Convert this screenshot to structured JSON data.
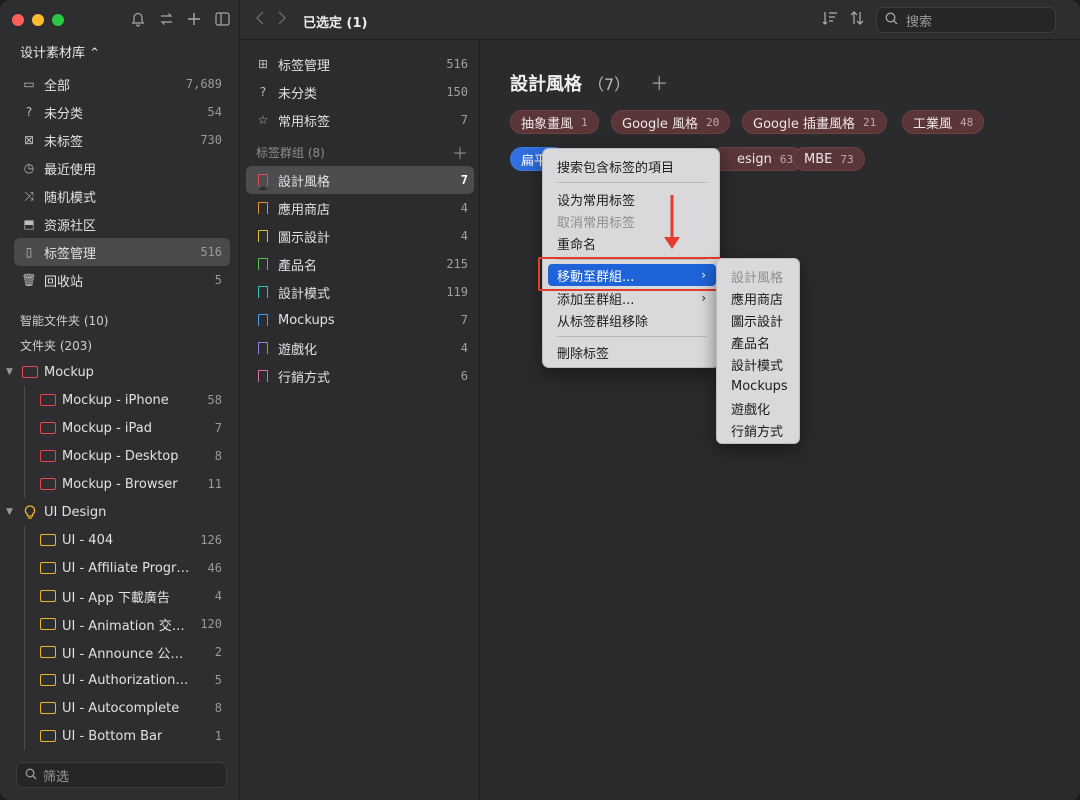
{
  "sidebar": {
    "library_title": "设计素材库 ⌃",
    "nav": [
      {
        "label": "全部",
        "count": "7,689",
        "icon": "inbox-icon",
        "glyph": "▭"
      },
      {
        "label": "未分类",
        "count": "54",
        "icon": "unsorted-icon",
        "glyph": "?"
      },
      {
        "label": "未标签",
        "count": "730",
        "icon": "untagged-icon",
        "glyph": "⊠"
      },
      {
        "label": "最近使用",
        "count": "",
        "icon": "clock-icon",
        "glyph": "◷"
      },
      {
        "label": "随机模式",
        "count": "",
        "icon": "shuffle-icon",
        "glyph": "⤨"
      },
      {
        "label": "资源社区",
        "count": "",
        "icon": "community-icon",
        "glyph": "⬒"
      },
      {
        "label": "标签管理",
        "count": "516",
        "icon": "bookmark-icon",
        "glyph": "▯"
      },
      {
        "label": "回收站",
        "count": "5",
        "icon": "trash-icon",
        "glyph": "🗑"
      }
    ],
    "smart_folders_label": "智能文件夹 (10)",
    "folders_label": "文件夹 (203)",
    "mockup_group": {
      "label": "Mockup",
      "children": [
        {
          "label": "Mockup - iPhone",
          "count": "58"
        },
        {
          "label": "Mockup - iPad",
          "count": "7"
        },
        {
          "label": "Mockup - Desktop",
          "count": "8"
        },
        {
          "label": "Mockup - Browser",
          "count": "11"
        }
      ]
    },
    "ui_group": {
      "label": "UI Design",
      "children": [
        {
          "label": "UI - 404",
          "count": "126"
        },
        {
          "label": "UI - Affiliate Progra...",
          "count": "46"
        },
        {
          "label": "UI - App 下載廣告",
          "count": "4"
        },
        {
          "label": "UI - Animation 交互...",
          "count": "120"
        },
        {
          "label": "UI - Announce 公告...",
          "count": "2"
        },
        {
          "label": "UI - Authorization ...",
          "count": "5"
        },
        {
          "label": "UI - Autocomplete",
          "count": "8"
        },
        {
          "label": "UI - Bottom Bar",
          "count": "1"
        }
      ]
    },
    "filter_placeholder": "筛选"
  },
  "topbar": {
    "title": "已选定 (1)",
    "search_placeholder": "搜索"
  },
  "middle": {
    "top_items": [
      {
        "label": "标签管理",
        "count": "516",
        "glyph": "⊞"
      },
      {
        "label": "未分类",
        "count": "150",
        "glyph": "?"
      },
      {
        "label": "常用标签",
        "count": "7",
        "glyph": "☆"
      }
    ],
    "group_label": "标签群组 (8)",
    "groups": [
      {
        "label": "設計風格",
        "count": "7",
        "color": "#e5484d"
      },
      {
        "label": "應用商店",
        "count": "4",
        "color": "#f08c2e"
      },
      {
        "label": "圖示設計",
        "count": "4",
        "color": "#e5c02b"
      },
      {
        "label": "產品名",
        "count": "215",
        "color": "#52c24a"
      },
      {
        "label": "設計模式",
        "count": "119",
        "color": "#2ec4b6"
      },
      {
        "label": "Mockups",
        "count": "7",
        "color": "#3b9ff0"
      },
      {
        "label": "遊戲化",
        "count": "4",
        "color": "#9b7be8"
      },
      {
        "label": "行銷方式",
        "count": "6",
        "color": "#e86ab0"
      }
    ]
  },
  "main": {
    "heading": "設計風格",
    "heading_count": "（7）",
    "tags": [
      {
        "label": "抽象畫風",
        "count": "1"
      },
      {
        "label": "Google 風格",
        "count": "20"
      },
      {
        "label": "Google 插畫風格",
        "count": "21"
      },
      {
        "label": "工業風",
        "count": "48"
      },
      {
        "label": "扁平",
        "count": ""
      },
      {
        "label": "esign",
        "count": "63"
      },
      {
        "label": "MBE",
        "count": "73"
      }
    ]
  },
  "context_menu": {
    "items": [
      {
        "label": "搜索包含标签的項目"
      },
      {
        "label": "设为常用标签"
      },
      {
        "label": "取消常用标签"
      },
      {
        "label": "重命名"
      },
      {
        "label": "移動至群組..."
      },
      {
        "label": "添加至群組..."
      },
      {
        "label": "从标签群组移除"
      },
      {
        "label": "刪除标签"
      }
    ]
  },
  "submenu": {
    "items": [
      "設計風格",
      "應用商店",
      "圖示設計",
      "產品名",
      "設計模式",
      "Mockups",
      "遊戲化",
      "行銷方式"
    ]
  },
  "colors": {
    "accent": "#1f63d8",
    "highlight": "#e43b2f",
    "tag_bg": "#5a3638"
  }
}
